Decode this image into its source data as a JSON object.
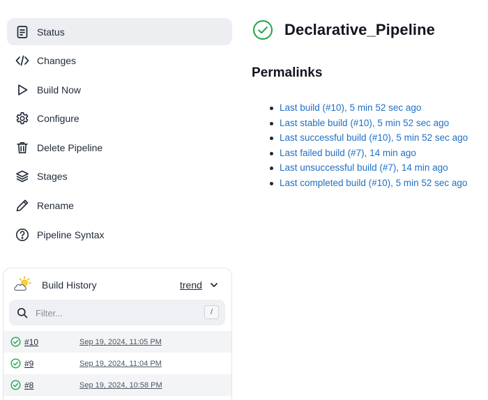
{
  "sidebar": {
    "items": [
      {
        "label": "Status",
        "icon": "document-icon",
        "active": true
      },
      {
        "label": "Changes",
        "icon": "code-icon"
      },
      {
        "label": "Build Now",
        "icon": "play-icon"
      },
      {
        "label": "Configure",
        "icon": "gear-icon"
      },
      {
        "label": "Delete Pipeline",
        "icon": "trash-icon"
      },
      {
        "label": "Stages",
        "icon": "layers-icon"
      },
      {
        "label": "Rename",
        "icon": "pencil-icon"
      },
      {
        "label": "Pipeline Syntax",
        "icon": "help-icon"
      }
    ]
  },
  "build_history": {
    "title": "Build History",
    "trend_label": "trend",
    "filter_placeholder": "Filter...",
    "filter_shortcut": "/",
    "builds": [
      {
        "number": "#10",
        "date": "Sep 19, 2024, 11:05 PM",
        "status": "success"
      },
      {
        "number": "#9",
        "date": "Sep 19, 2024, 11:04 PM",
        "status": "success"
      },
      {
        "number": "#8",
        "date": "Sep 19, 2024, 10:58 PM",
        "status": "success"
      }
    ]
  },
  "main": {
    "job_title": "Declarative_Pipeline",
    "permalinks_title": "Permalinks",
    "permalinks": [
      "Last build (#10), 5 min 52 sec ago",
      "Last stable build (#10), 5 min 52 sec ago",
      "Last successful build (#10), 5 min 52 sec ago",
      "Last failed build (#7), 14 min ago",
      "Last unsuccessful build (#7), 14 min ago",
      "Last completed build (#10), 5 min 52 sec ago"
    ]
  },
  "colors": {
    "success": "#1ea446",
    "link": "#1f6fc5",
    "active_bg": "#eceef2"
  }
}
